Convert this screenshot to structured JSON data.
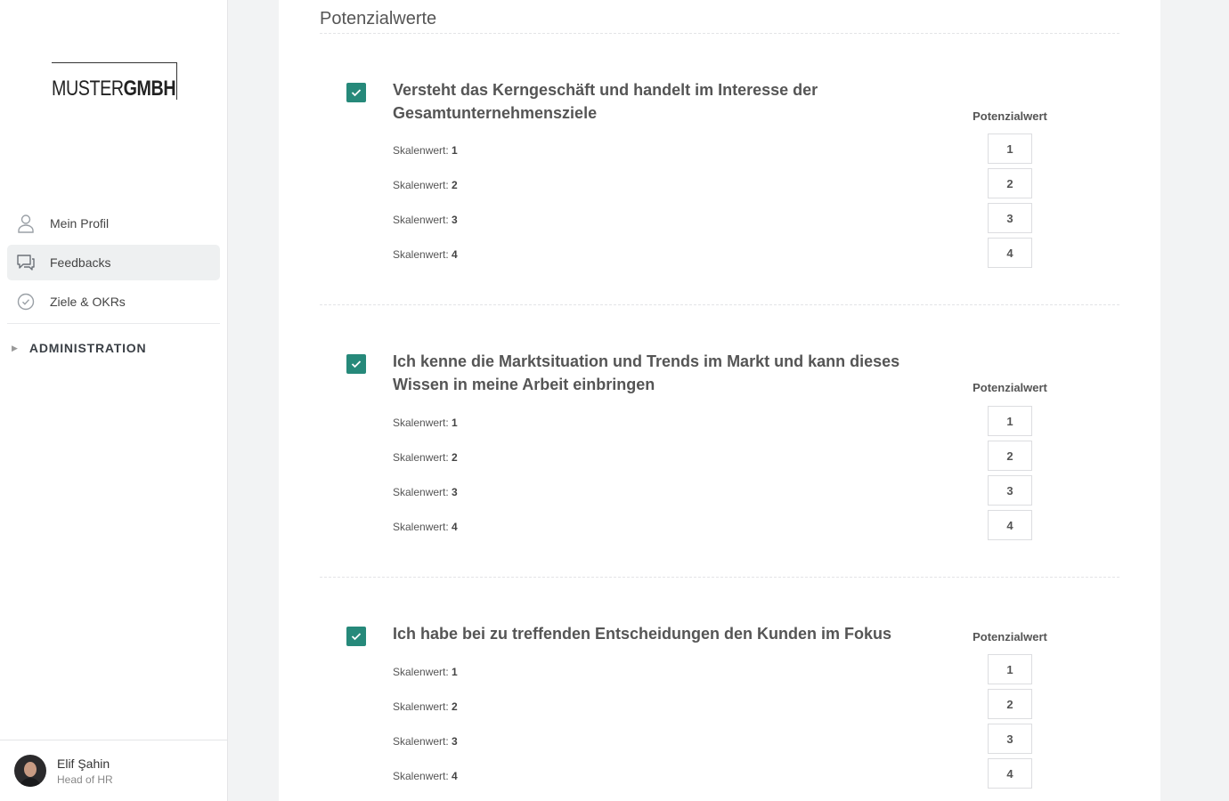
{
  "brand": {
    "logo_light": "MUSTER",
    "logo_bold": "GMBH"
  },
  "nav": {
    "items": [
      {
        "label": "Mein Profil",
        "icon": "user-icon"
      },
      {
        "label": "Feedbacks",
        "icon": "chat-icon",
        "active": true
      },
      {
        "label": "Ziele & OKRs",
        "icon": "check-circle-icon"
      }
    ],
    "admin_label": "ADMINISTRATION"
  },
  "user": {
    "name": "Elif Şahin",
    "role": "Head of HR"
  },
  "section": {
    "title": "Potenzialwerte"
  },
  "scale_prefix": "Skalenwert:",
  "potential_label": "Potenzialwert",
  "items": [
    {
      "title": "Versteht das Kerngeschäft und handelt im Interesse der Gesamtunternehmensziele",
      "checked": true,
      "scale_values": [
        "1",
        "2",
        "3",
        "4"
      ],
      "options": [
        "1",
        "2",
        "3",
        "4"
      ]
    },
    {
      "title": "Ich kenne die Marktsituation und Trends im Markt und kann dieses Wissen in meine Arbeit einbringen",
      "checked": true,
      "scale_values": [
        "1",
        "2",
        "3",
        "4"
      ],
      "options": [
        "1",
        "2",
        "3",
        "4"
      ]
    },
    {
      "title": "Ich habe bei zu treffenden Entscheidungen den Kunden im Fokus",
      "checked": true,
      "scale_values": [
        "1",
        "2",
        "3",
        "4"
      ],
      "options": [
        "1",
        "2",
        "3",
        "4"
      ]
    }
  ],
  "colors": {
    "accent": "#26897a",
    "active_bg": "#eef0f1",
    "page_bg": "#f2f3f4"
  }
}
